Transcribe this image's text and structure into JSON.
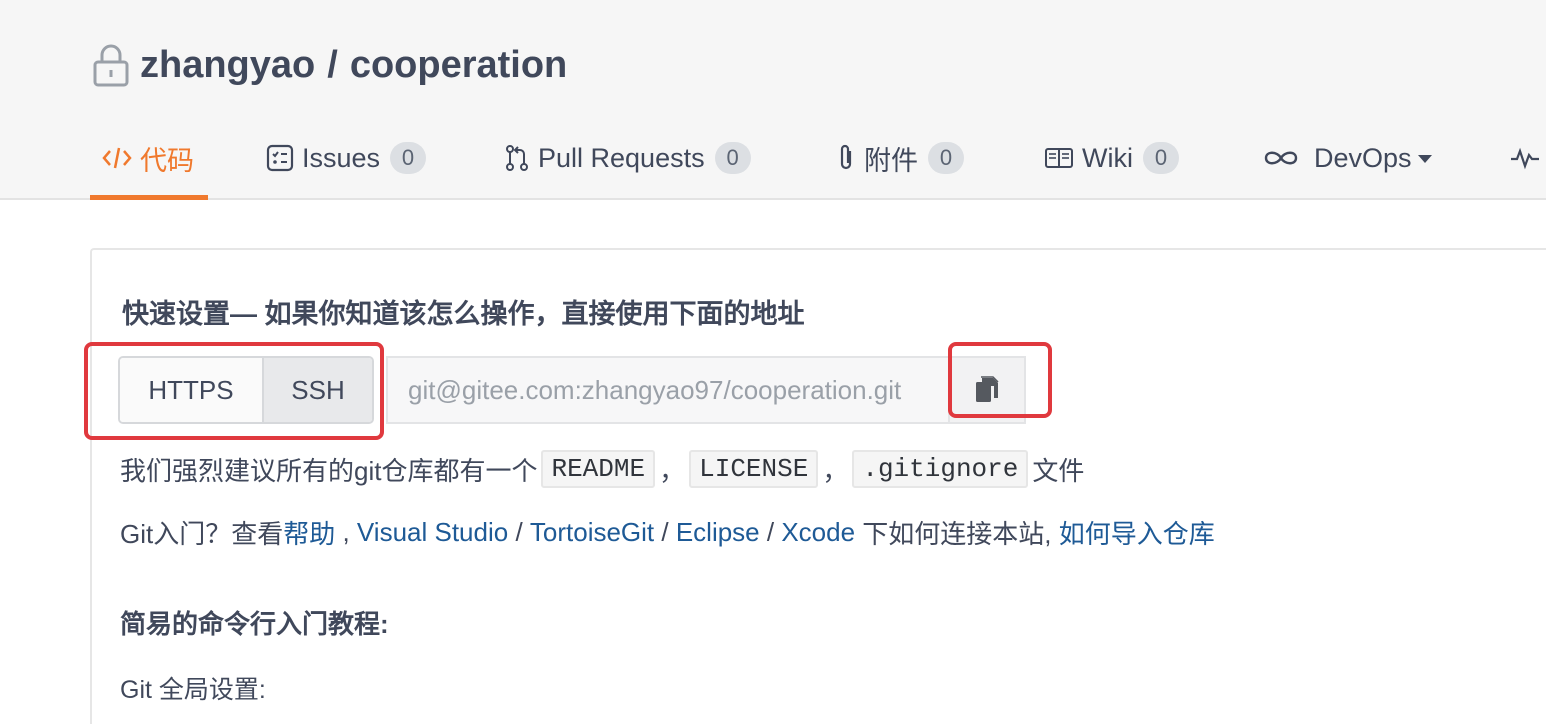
{
  "repo": {
    "owner": "zhangyao",
    "separator": "/",
    "name": "cooperation"
  },
  "tabs": [
    {
      "label": "代码",
      "icon": "code-icon",
      "active": true
    },
    {
      "label": "Issues",
      "count": "0",
      "icon": "issues-icon"
    },
    {
      "label": "Pull Requests",
      "count": "0",
      "icon": "pull-request-icon"
    },
    {
      "label": "附件",
      "count": "0",
      "icon": "paperclip-icon"
    },
    {
      "label": "Wiki",
      "count": "0",
      "icon": "book-icon"
    },
    {
      "label": "DevOps",
      "icon": "infinity-icon",
      "dropdown": true
    },
    {
      "label": "",
      "icon": "pulse-icon"
    }
  ],
  "quick_setup": {
    "title": "快速设置— 如果你知道该怎么操作，直接使用下面的地址",
    "protocols": [
      "HTTPS",
      "SSH"
    ],
    "selected_protocol": "SSH",
    "url": "git@gitee.com:zhangyao97/cooperation.git",
    "copy_icon": "copy-icon"
  },
  "recommend": {
    "prefix": "我们强烈建议所有的git仓库都有一个",
    "files": [
      "README",
      "LICENSE",
      ".gitignore"
    ],
    "sep": "，",
    "suffix": "文件"
  },
  "help": {
    "prefix": "Git入门？查看 ",
    "help_link": "帮助",
    "comma": " , ",
    "vs": "Visual Studio",
    "slash": " / ",
    "tortoise": "TortoiseGit",
    "eclipse": "Eclipse",
    "xcode": "Xcode",
    "middle": " 下如何连接本站, ",
    "import_link": "如何导入仓库"
  },
  "tutorial": {
    "title": "简易的命令行入门教程:",
    "global_setup": "Git 全局设置:"
  },
  "colors": {
    "accent": "#f0792d",
    "link": "#1e5a96",
    "highlight": "#e0393e"
  }
}
